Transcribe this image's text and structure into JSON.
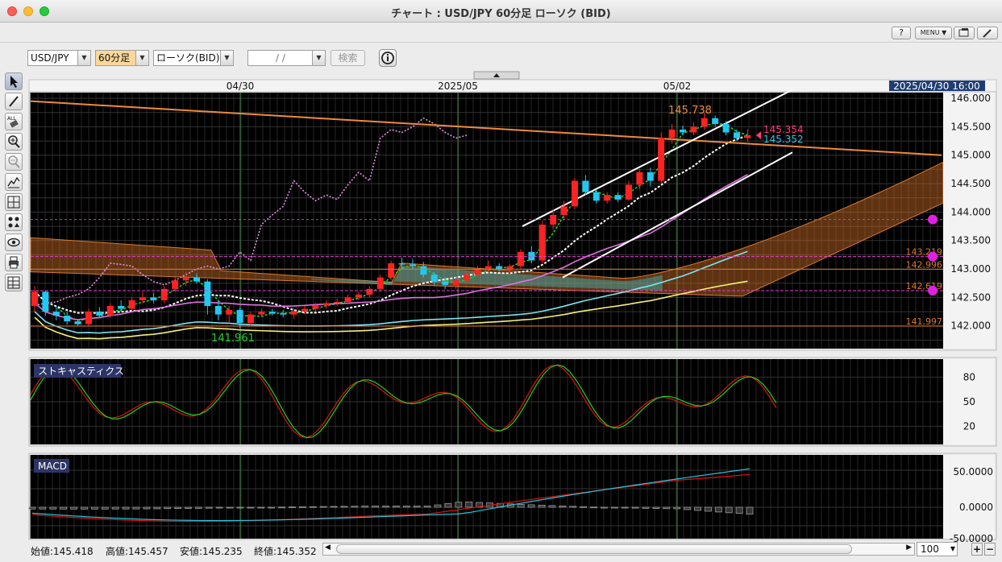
{
  "window": {
    "title": "チャート : USD/JPY 60分足 ローソク (BID)"
  },
  "menubar": {
    "help_label": "?",
    "menu_label": "MENU ▼"
  },
  "toolbar": {
    "symbol": "USD/JPY",
    "timeframe": "60分足",
    "chart_type": "ローソク(BID)",
    "date_value": "/      /",
    "search_label": "検索"
  },
  "colors": {
    "bull": "#ff2222",
    "bear": "#22c8f0",
    "bg": "#000000",
    "grid": "#2e2e2e"
  },
  "time_axis": {
    "labels": [
      {
        "text": "04/30",
        "x": 313
      },
      {
        "text": "2025/05",
        "x": 594
      },
      {
        "text": "05/02",
        "x": 858
      }
    ],
    "cursor_time": "2025/04/30 16:00"
  },
  "chart_data": [
    {
      "type": "candlestick",
      "title": "",
      "price_axis": {
        "ticks": [
          146.0,
          145.5,
          145.0,
          144.5,
          144.0,
          143.5,
          143.0,
          142.5,
          142.0
        ],
        "ylim": [
          141.6,
          146.1
        ]
      },
      "annotations": {
        "high": "145.738",
        "low": "141.961"
      },
      "candles": [
        [
          142.35,
          142.7,
          142.25,
          142.6
        ],
        [
          142.6,
          142.62,
          142.18,
          142.25
        ],
        [
          142.25,
          142.35,
          142.1,
          142.18
        ],
        [
          142.18,
          142.25,
          142.02,
          142.08
        ],
        [
          142.08,
          142.12,
          142.0,
          142.03
        ],
        [
          142.03,
          142.3,
          142.0,
          142.25
        ],
        [
          142.25,
          142.33,
          142.15,
          142.18
        ],
        [
          142.18,
          142.4,
          142.15,
          142.35
        ],
        [
          142.35,
          142.45,
          142.25,
          142.3
        ],
        [
          142.3,
          142.5,
          142.28,
          142.45
        ],
        [
          142.45,
          142.6,
          142.4,
          142.5
        ],
        [
          142.5,
          142.58,
          142.4,
          142.45
        ],
        [
          142.45,
          142.7,
          142.4,
          142.65
        ],
        [
          142.65,
          142.85,
          142.6,
          142.8
        ],
        [
          142.8,
          142.95,
          142.7,
          142.85
        ],
        [
          142.85,
          142.92,
          142.75,
          142.78
        ],
        [
          142.78,
          142.82,
          142.2,
          142.35
        ],
        [
          142.35,
          142.45,
          142.1,
          142.2
        ],
        [
          142.2,
          142.35,
          142.05,
          142.28
        ],
        [
          142.28,
          142.32,
          141.96,
          142.05
        ],
        [
          142.05,
          142.25,
          142.0,
          142.2
        ],
        [
          142.2,
          142.3,
          142.15,
          142.25
        ],
        [
          142.25,
          142.3,
          142.18,
          142.22
        ],
        [
          142.22,
          142.28,
          142.15,
          142.2
        ],
        [
          142.2,
          142.3,
          142.12,
          142.26
        ],
        [
          142.26,
          142.35,
          142.2,
          142.3
        ],
        [
          142.3,
          142.4,
          142.25,
          142.36
        ],
        [
          142.36,
          142.45,
          142.3,
          142.4
        ],
        [
          142.4,
          142.48,
          142.35,
          142.42
        ],
        [
          142.42,
          142.55,
          142.38,
          142.5
        ],
        [
          142.5,
          142.6,
          142.45,
          142.55
        ],
        [
          142.55,
          142.7,
          142.5,
          142.65
        ],
        [
          142.65,
          142.9,
          142.6,
          142.85
        ],
        [
          142.85,
          143.15,
          142.8,
          143.1
        ],
        [
          143.1,
          143.2,
          143.0,
          143.08
        ],
        [
          143.08,
          143.18,
          143.0,
          143.05
        ],
        [
          143.05,
          143.12,
          142.85,
          142.9
        ],
        [
          142.9,
          142.95,
          142.7,
          142.78
        ],
        [
          142.78,
          142.85,
          142.65,
          142.72
        ],
        [
          142.72,
          142.85,
          142.65,
          142.8
        ],
        [
          142.8,
          142.95,
          142.75,
          142.9
        ],
        [
          142.9,
          143.05,
          142.85,
          143.0
        ],
        [
          143.0,
          143.15,
          142.95,
          143.05
        ],
        [
          143.05,
          143.1,
          142.95,
          143.0
        ],
        [
          143.0,
          143.08,
          142.92,
          143.05
        ],
        [
          143.05,
          143.35,
          143.0,
          143.3
        ],
        [
          143.3,
          143.4,
          143.1,
          143.15
        ],
        [
          143.15,
          143.85,
          143.1,
          143.78
        ],
        [
          143.78,
          144.05,
          143.7,
          143.95
        ],
        [
          143.95,
          144.2,
          143.85,
          144.1
        ],
        [
          144.1,
          144.6,
          144.05,
          144.55
        ],
        [
          144.55,
          144.65,
          144.3,
          144.35
        ],
        [
          144.35,
          144.4,
          144.15,
          144.2
        ],
        [
          144.2,
          144.35,
          144.15,
          144.3
        ],
        [
          144.3,
          144.35,
          144.18,
          144.22
        ],
        [
          144.22,
          144.55,
          144.2,
          144.48
        ],
        [
          144.48,
          144.75,
          144.4,
          144.7
        ],
        [
          144.7,
          144.78,
          144.45,
          144.55
        ],
        [
          144.55,
          145.4,
          144.5,
          145.3
        ],
        [
          145.3,
          145.55,
          145.2,
          145.45
        ],
        [
          145.45,
          145.52,
          145.35,
          145.4
        ],
        [
          145.4,
          145.58,
          145.35,
          145.5
        ],
        [
          145.5,
          145.74,
          145.45,
          145.65
        ],
        [
          145.65,
          145.7,
          145.5,
          145.55
        ],
        [
          145.55,
          145.6,
          145.35,
          145.4
        ],
        [
          145.4,
          145.45,
          145.25,
          145.3
        ],
        [
          145.3,
          145.46,
          145.24,
          145.35
        ]
      ],
      "lines": {
        "resistance": [
          [
            0,
            145.95
          ],
          [
            1130,
            145.0
          ]
        ],
        "channel_upper": [
          [
            610,
            143.75
          ],
          [
            945,
            146.15
          ]
        ],
        "channel_lower": [
          [
            660,
            142.85
          ],
          [
            945,
            145.05
          ]
        ]
      },
      "horizontal_levels": [
        {
          "value": 143.219,
          "label": "143.219"
        },
        {
          "value": 142.996,
          "label": "142.996"
        },
        {
          "value": 142.619,
          "label": "142.619"
        },
        {
          "value": 141.997,
          "label": "141.997"
        }
      ],
      "price_tags": [
        {
          "label": "145.354"
        },
        {
          "label": "145.352"
        }
      ]
    },
    {
      "type": "line",
      "title": "ストキャスティクス",
      "ticks": [
        80,
        50,
        20
      ],
      "ylim": [
        0,
        100
      ]
    },
    {
      "type": "line",
      "title": "MACD",
      "ticks": [
        "50.0000",
        "0.0000",
        "-50.0000"
      ]
    }
  ],
  "status": {
    "open": "始値:145.418",
    "high": "高値:145.457",
    "low": "安値:145.235",
    "close": "終値:145.352",
    "zoom": "100"
  }
}
